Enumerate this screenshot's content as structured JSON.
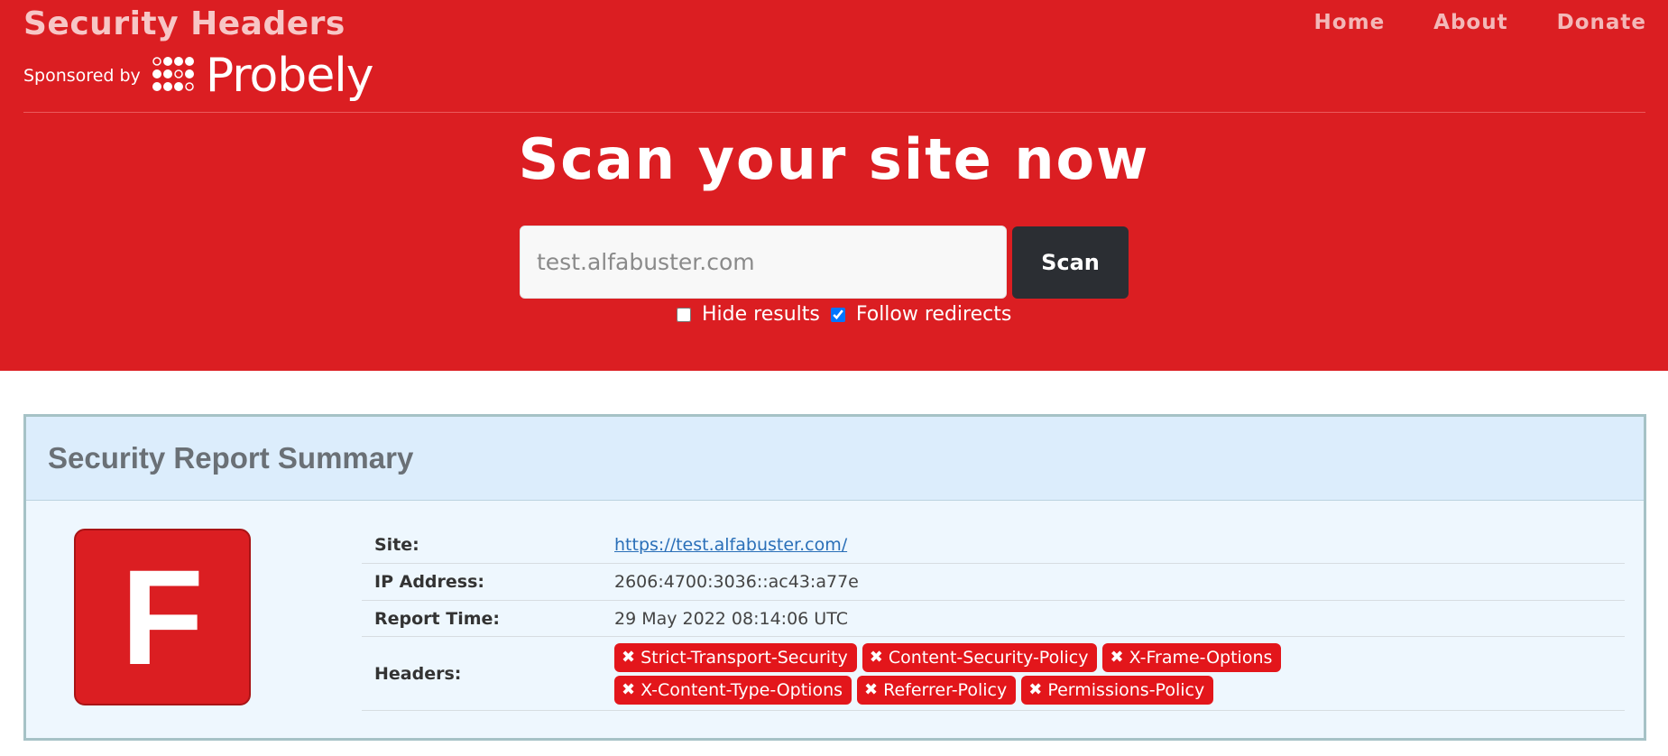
{
  "brand": {
    "title": "Security Headers",
    "sponsored_by": "Sponsored by",
    "sponsor_name": "Probely"
  },
  "nav": {
    "items": [
      "Home",
      "About",
      "Donate"
    ]
  },
  "hero": {
    "title": "Scan your site now"
  },
  "search": {
    "placeholder": "test.alfabuster.com",
    "value": "",
    "button_label": "Scan"
  },
  "options": {
    "hide_results": {
      "label": "Hide results",
      "checked": false
    },
    "follow_redirects": {
      "label": "Follow redirects",
      "checked": true
    }
  },
  "report": {
    "title": "Security Report Summary",
    "grade": "F",
    "rows": {
      "site": {
        "label": "Site:",
        "value": "https://test.alfabuster.com/"
      },
      "ip": {
        "label": "IP Address:",
        "value": "2606:4700:3036::ac43:a77e"
      },
      "time": {
        "label": "Report Time:",
        "value": "29 May 2022 08:14:06 UTC"
      },
      "headers": {
        "label": "Headers:"
      }
    },
    "headers_missing": [
      "Strict-Transport-Security",
      "Content-Security-Policy",
      "X-Frame-Options",
      "X-Content-Type-Options",
      "Referrer-Policy",
      "Permissions-Policy"
    ],
    "missing_mark": "✖"
  },
  "colors": {
    "header_bg": "#db1e22",
    "scan_button": "#2b2e33",
    "report_bg": "#eef7fe",
    "report_head_bg": "#dcedfc",
    "pill_bg": "#e3161b"
  }
}
